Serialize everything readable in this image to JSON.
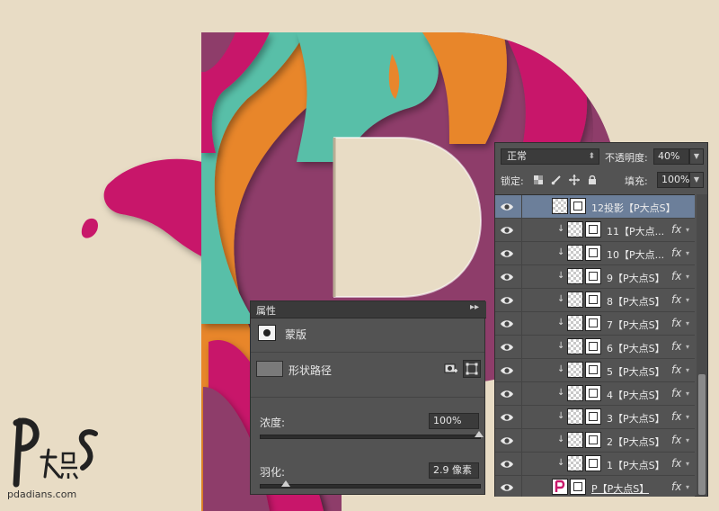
{
  "colors": {
    "background": "#e8dcc5",
    "magenta": "#c8186a",
    "plum": "#8e3d6a",
    "teal": "#58bfa8",
    "orange": "#e8862c",
    "panel": "#535353",
    "selected_row": "#6c7f9a"
  },
  "layers_panel": {
    "blend_mode": "正常",
    "opacity_label": "不透明度:",
    "opacity_value": "40%",
    "lock_label": "锁定:",
    "fill_label": "填充:",
    "fill_value": "100%",
    "lock_icons": [
      "lock-transparent-icon",
      "lock-paint-icon",
      "lock-move-icon",
      "lock-all-icon"
    ],
    "layers": [
      {
        "name": "12投影【P大点S】",
        "selected": true,
        "clipped": false,
        "fx": false,
        "thumb": "checker"
      },
      {
        "name": "11【P大点...",
        "selected": false,
        "clipped": true,
        "fx": true,
        "thumb": "checker"
      },
      {
        "name": "10【P大点...",
        "selected": false,
        "clipped": true,
        "fx": true,
        "thumb": "checker"
      },
      {
        "name": "9【P大点S】",
        "selected": false,
        "clipped": true,
        "fx": true,
        "thumb": "checker"
      },
      {
        "name": "8【P大点S】",
        "selected": false,
        "clipped": true,
        "fx": true,
        "thumb": "checker"
      },
      {
        "name": "7【P大点S】",
        "selected": false,
        "clipped": true,
        "fx": true,
        "thumb": "checker"
      },
      {
        "name": "6【P大点S】",
        "selected": false,
        "clipped": true,
        "fx": true,
        "thumb": "checker"
      },
      {
        "name": "5【P大点S】",
        "selected": false,
        "clipped": true,
        "fx": true,
        "thumb": "checker"
      },
      {
        "name": "4【P大点S】",
        "selected": false,
        "clipped": true,
        "fx": true,
        "thumb": "checker"
      },
      {
        "name": "3【P大点S】",
        "selected": false,
        "clipped": true,
        "fx": true,
        "thumb": "checker"
      },
      {
        "name": "2【P大点S】",
        "selected": false,
        "clipped": true,
        "fx": true,
        "thumb": "checker"
      },
      {
        "name": "1【P大点S】",
        "selected": false,
        "clipped": true,
        "fx": true,
        "thumb": "checker"
      },
      {
        "name": "P【P大点S】",
        "selected": false,
        "clipped": false,
        "fx": true,
        "thumb": "letter"
      }
    ]
  },
  "properties_panel": {
    "title": "属性",
    "mask_type": "蒙版",
    "shape_path": "形状路径",
    "density_label": "浓度:",
    "density_value": "100%",
    "density_level": 1.0,
    "feather_label": "羽化:",
    "feather_value": "2.9 像素",
    "feather_level": 0.12
  },
  "watermark": {
    "url": "pdadians.com"
  }
}
